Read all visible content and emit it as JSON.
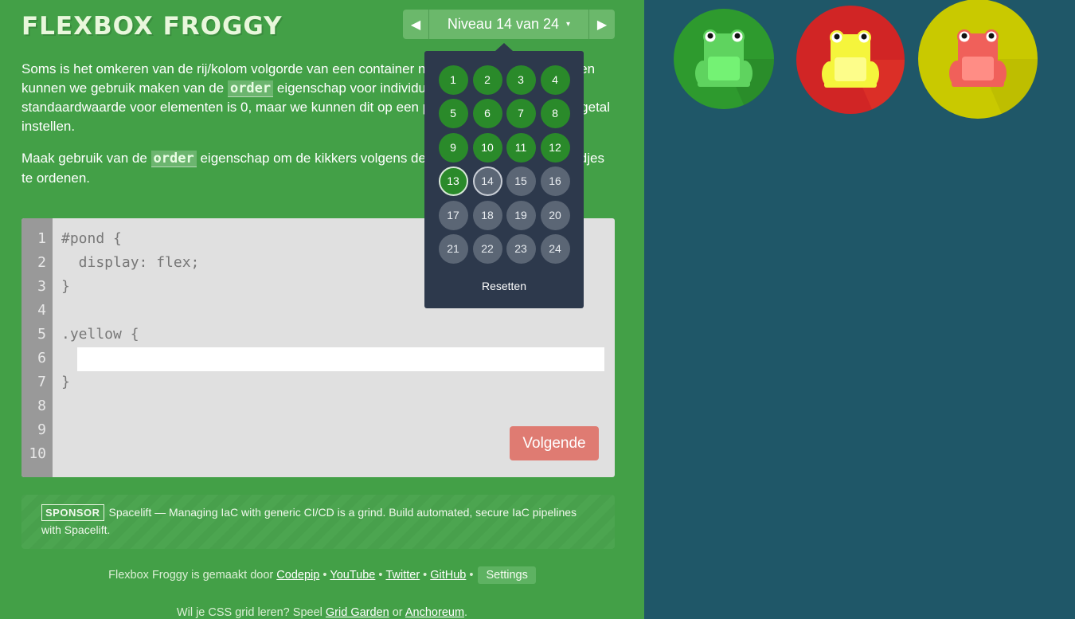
{
  "app": {
    "title": "FLEXBOX FROGGY"
  },
  "level_nav": {
    "prev_icon": "chevron-left-icon",
    "next_icon": "chevron-right-icon",
    "indicator": "Niveau 14 van 24",
    "caret": "▾"
  },
  "instructions": {
    "p1_a": "Soms is het omkeren van de rij/kolom volgorde van een container niet genoeg. In deze gevallen kunnen we gebruik maken van de ",
    "p1_code": "order",
    "p1_b": " eigenschap voor individuele elementen. De standaardwaarde voor elementen is 0, maar we kunnen dit op een positief of negatief geheel getal instellen.",
    "p2_a": "Maak gebruik van de ",
    "p2_code": "order",
    "p2_b": " eigenschap om de kikkers volgens de kleuren van hun lelieblaadjes te ordenen."
  },
  "editor": {
    "line_numbers": [
      "1",
      "2",
      "3",
      "4",
      "5",
      "6",
      "7",
      "8",
      "9",
      "10"
    ],
    "lines": [
      "#pond {",
      "  display: flex;",
      "}",
      "",
      ".yellow {",
      "",
      "}"
    ],
    "input_value": "",
    "next_button": "Volgende"
  },
  "level_menu": {
    "levels": [
      {
        "n": "1",
        "state": "solved"
      },
      {
        "n": "2",
        "state": "solved"
      },
      {
        "n": "3",
        "state": "solved"
      },
      {
        "n": "4",
        "state": "solved"
      },
      {
        "n": "5",
        "state": "solved"
      },
      {
        "n": "6",
        "state": "solved"
      },
      {
        "n": "7",
        "state": "solved"
      },
      {
        "n": "8",
        "state": "solved"
      },
      {
        "n": "9",
        "state": "solved"
      },
      {
        "n": "10",
        "state": "solved"
      },
      {
        "n": "11",
        "state": "solved"
      },
      {
        "n": "12",
        "state": "solved"
      },
      {
        "n": "13",
        "state": "solved-current"
      },
      {
        "n": "14",
        "state": "current"
      },
      {
        "n": "15",
        "state": "unsolved"
      },
      {
        "n": "16",
        "state": "unsolved"
      },
      {
        "n": "17",
        "state": "unsolved"
      },
      {
        "n": "18",
        "state": "unsolved"
      },
      {
        "n": "19",
        "state": "unsolved"
      },
      {
        "n": "20",
        "state": "unsolved"
      },
      {
        "n": "21",
        "state": "unsolved"
      },
      {
        "n": "22",
        "state": "unsolved"
      },
      {
        "n": "23",
        "state": "unsolved"
      },
      {
        "n": "24",
        "state": "unsolved"
      }
    ],
    "reset": "Resetten"
  },
  "sponsor": {
    "badge": "SPONSOR",
    "text": "Spacelift — Managing IaC with generic CI/CD is a grind. Build automated, secure IaC pipelines with Spacelift."
  },
  "footer": {
    "made_by": "Flexbox Froggy is gemaakt door",
    "codepip": "Codepip",
    "youtube": "YouTube",
    "twitter": "Twitter",
    "github": "GitHub",
    "sep": "•",
    "settings": "Settings",
    "grid_text": "Wil je CSS grid leren? Speel",
    "grid_garden": "Grid Garden",
    "or": "or",
    "anchoreum": "Anchoreum",
    "period": "."
  },
  "pond": {
    "frogs": [
      {
        "color": "green",
        "pad": "#2e9a2e",
        "pad_dark": "#258025",
        "body": "#5fd35f",
        "belly": "#74f274"
      },
      {
        "color": "red",
        "pad": "#d12525",
        "pad_dark": "#e53a2a",
        "body": "#f5f53c",
        "belly": "#fdfd8a"
      },
      {
        "color": "yellow",
        "pad": "#c9c900",
        "pad_dark": "#b4b400",
        "body": "#f0605a",
        "belly": "#ff8d85"
      }
    ]
  },
  "colors": {
    "sidebar": "#43a047",
    "pond": "#1f5768",
    "dropdown": "#2d394c",
    "next_button": "#df7b72"
  }
}
